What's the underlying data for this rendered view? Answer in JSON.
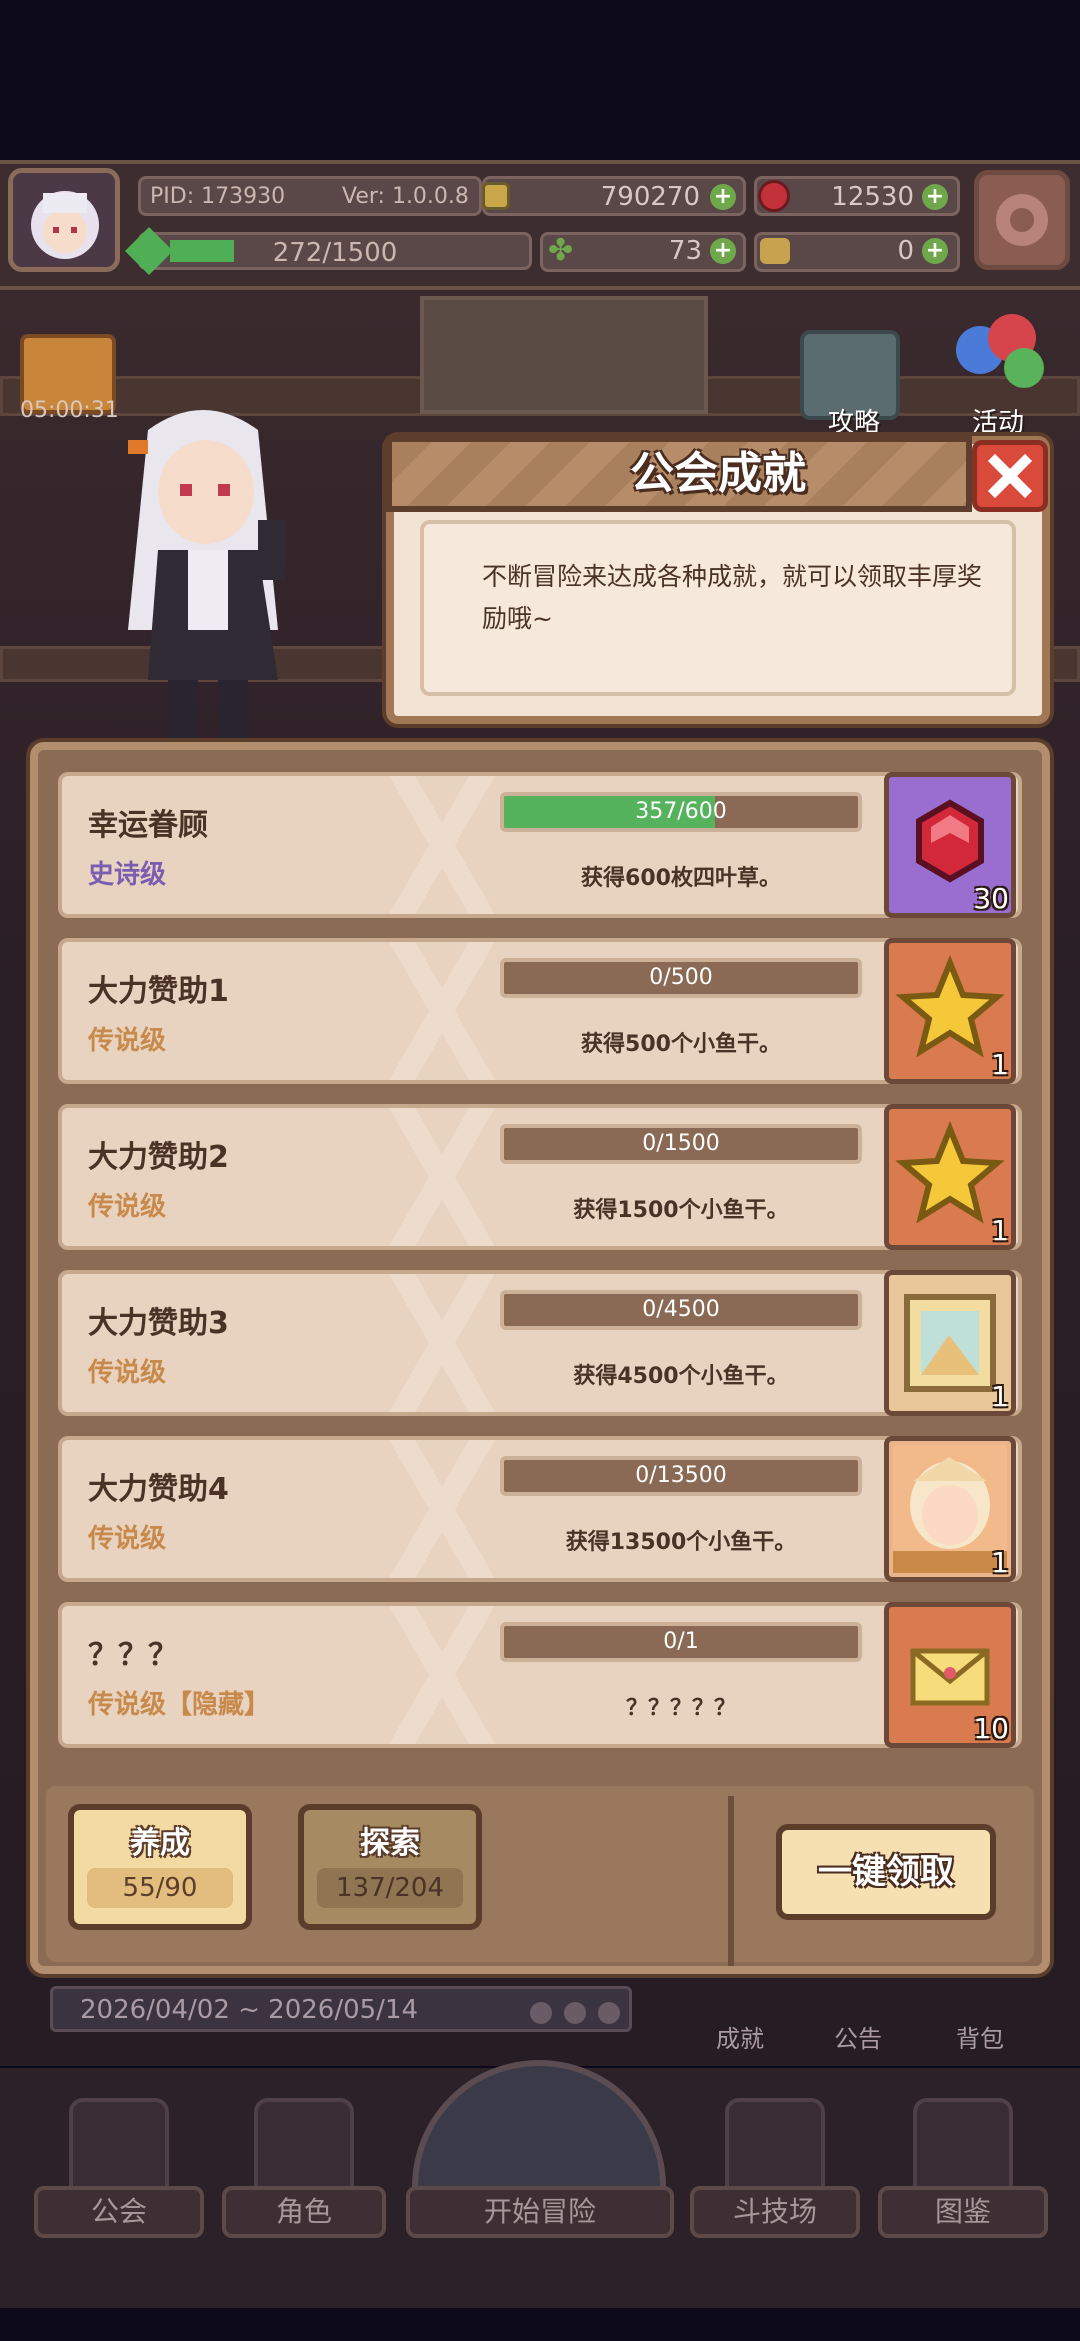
{
  "status_bar": {
    "pid": "PID: 173930",
    "version": "Ver: 1.0.0.8",
    "gold": "790270",
    "gems": "12530",
    "xp": "272/1500",
    "xp_progress": 0.181,
    "clover": "73",
    "fish": "0"
  },
  "background": {
    "timer": "05:00:31",
    "guide_label": "攻略",
    "event_label": "活动"
  },
  "dialog": {
    "title": "公会成就",
    "description": "不断冒险来达成各种成就，就可以领取丰厚奖励哦~"
  },
  "achievements": [
    {
      "name": "幸运眷顾",
      "rarity": "史诗级",
      "rarity_color": "#7a5cb0",
      "progress_text": "357/600",
      "progress": 0.595,
      "desc": "获得600枚四叶草。",
      "reward_icon": "ruby-icon",
      "reward_bg": "#9a6ed1",
      "reward_count": "30"
    },
    {
      "name": "大力赞助1",
      "rarity": "传说级",
      "rarity_color": "#c88a4b",
      "progress_text": "0/500",
      "progress": 0,
      "desc": "获得500个小鱼干。",
      "reward_icon": "star-icon",
      "reward_bg": "#d97a4f",
      "reward_count": "1"
    },
    {
      "name": "大力赞助2",
      "rarity": "传说级",
      "rarity_color": "#c88a4b",
      "progress_text": "0/1500",
      "progress": 0,
      "desc": "获得1500个小鱼干。",
      "reward_icon": "star-icon",
      "reward_bg": "#d97a4f",
      "reward_count": "1"
    },
    {
      "name": "大力赞助3",
      "rarity": "传说级",
      "rarity_color": "#c88a4b",
      "progress_text": "0/4500",
      "progress": 0,
      "desc": "获得4500个小鱼干。",
      "reward_icon": "frame-icon",
      "reward_bg": "#e9c79a",
      "reward_count": "1"
    },
    {
      "name": "大力赞助4",
      "rarity": "传说级",
      "rarity_color": "#c88a4b",
      "progress_text": "0/13500",
      "progress": 0,
      "desc": "获得13500个小鱼干。",
      "reward_icon": "portrait-icon",
      "reward_bg": "#e9b48a",
      "reward_count": "1"
    },
    {
      "name": "？？？",
      "rarity": "传说级【隐藏】",
      "rarity_color": "#c88a4b",
      "progress_text": "0/1",
      "progress": 0,
      "desc": "？？？？？",
      "reward_icon": "letter-icon",
      "reward_bg": "#d97a4f",
      "reward_count": "10"
    }
  ],
  "tabs": {
    "nurture_label": "养成",
    "nurture_count": "55/90",
    "explore_label": "探索",
    "explore_count": "137/204"
  },
  "claim_all_label": "一键领取",
  "date_range": "2026/04/02 ~ 2026/05/14",
  "side_menu": {
    "achievement": "成就",
    "notice": "公告",
    "backpack": "背包"
  },
  "nav": {
    "guild": "公会",
    "character": "角色",
    "adventure": "开始冒险",
    "arena": "斗技场",
    "codex": "图鉴"
  }
}
